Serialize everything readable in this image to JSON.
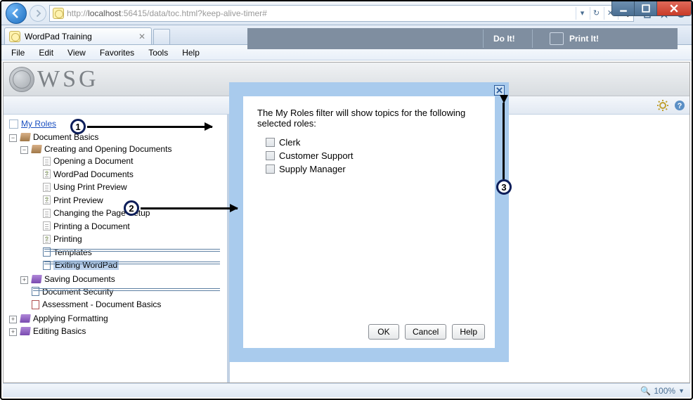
{
  "browser": {
    "url_dim1": "http://",
    "url_host": "localhost",
    "url_rest": ":56415/data/toc.html?keep-alive-timer#",
    "tab_title": "WordPad Training",
    "zoom": "100%"
  },
  "menu": {
    "file": "File",
    "edit": "Edit",
    "view": "View",
    "favorites": "Favorites",
    "tools": "Tools",
    "help": "Help"
  },
  "logo": "WSG",
  "sidebar": {
    "my_roles": "My Roles",
    "root": "Document Basics",
    "sub1": "Creating and Opening Documents",
    "items": {
      "a": "Opening a Document",
      "b": "WordPad Documents",
      "c": "Using Print Preview",
      "d": "Print Preview",
      "e": "Changing the Page Setup",
      "f": "Printing a Document",
      "g": "Printing",
      "h": "Templates",
      "i": "Exiting WordPad"
    },
    "sub2": "Saving Documents",
    "sub3": "Document Security",
    "sub4": "Assessment - Document Basics",
    "root2": "Applying Formatting",
    "root3": "Editing Basics"
  },
  "mainframe": {
    "tab_do": "Do It!",
    "tab_print": "Print It!"
  },
  "modal": {
    "intro": "The My Roles filter will show topics for the following selected roles:",
    "roles": {
      "r1": "Clerk",
      "r2": "Customer Support",
      "r3": "Supply Manager"
    },
    "ok": "OK",
    "cancel": "Cancel",
    "help": "Help"
  },
  "callouts": {
    "c1": "1",
    "c2": "2",
    "c3": "3"
  }
}
